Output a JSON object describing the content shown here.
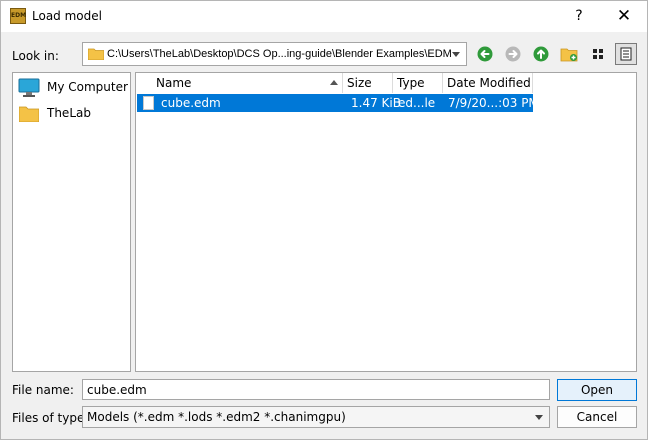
{
  "window": {
    "title": "Load model",
    "app_icon_text": "EDM",
    "help_label": "?",
    "close_label": "✕"
  },
  "lookin": {
    "label": "Look in:",
    "path": "C:\\Users\\TheLab\\Desktop\\DCS Op...ing-guide\\Blender Examples\\EDM"
  },
  "toolbar": {
    "icons": [
      "back-icon",
      "forward-icon",
      "parent-folder-icon",
      "new-folder-icon",
      "list-view-icon",
      "detail-view-icon"
    ]
  },
  "sidebar": {
    "items": [
      {
        "label": "My Computer",
        "icon": "computer-icon"
      },
      {
        "label": "TheLab",
        "icon": "folder-icon"
      }
    ]
  },
  "files": {
    "columns": [
      "Name",
      "Size",
      "Type",
      "Date Modified"
    ],
    "rows": [
      {
        "name": "cube.edm",
        "size": "1.47 KiB",
        "type": "ed...le",
        "date": "7/9/20...:03 PM",
        "selected": true
      }
    ]
  },
  "form": {
    "filename_label": "File name:",
    "filename_value": "cube.edm",
    "filetype_label": "Files of type:",
    "filetype_value": "Models (*.edm *.lods *.edm2 *.chanimgpu)",
    "open_label": "Open",
    "cancel_label": "Cancel"
  },
  "colors": {
    "selection": "#0078d7",
    "accent_green": "#2f9a3a",
    "folder": "#f4c246"
  }
}
